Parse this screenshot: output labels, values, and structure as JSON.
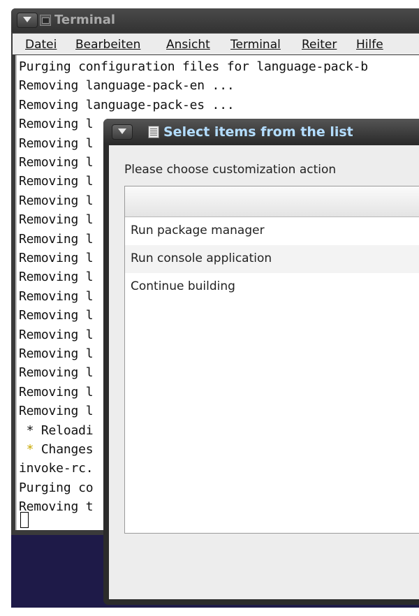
{
  "terminal": {
    "title": "Terminal",
    "menu": [
      "Datei",
      "Bearbeiten",
      "Ansicht",
      "Terminal",
      "Reiter",
      "Hilfe"
    ],
    "lines": [
      "Purging configuration files for language-pack-b",
      "Removing language-pack-en ...",
      "Removing language-pack-es ...",
      "Removing l",
      "Removing l",
      "Removing l",
      "Removing l",
      "Removing l",
      "Removing l",
      "Removing l",
      "Removing l",
      "Removing l",
      "Removing l",
      "Removing l",
      "Removing l",
      "Removing l",
      "Removing l",
      "Removing l",
      "Removing l",
      " Reloadi",
      " Changes",
      "invoke-rc.",
      "Purging co",
      "Removing t"
    ],
    "star_lines": {
      "19": "*",
      "20": "*"
    }
  },
  "dialog": {
    "title": "Select items from the list",
    "prompt": "Please choose customization action",
    "items": [
      "Run package manager",
      "Run console application",
      "Continue building"
    ]
  },
  "colors": {
    "desktop": "#1e1a48",
    "dialog_title": "#b3ddff",
    "terminal_bullet_warning": "#c8a800"
  }
}
